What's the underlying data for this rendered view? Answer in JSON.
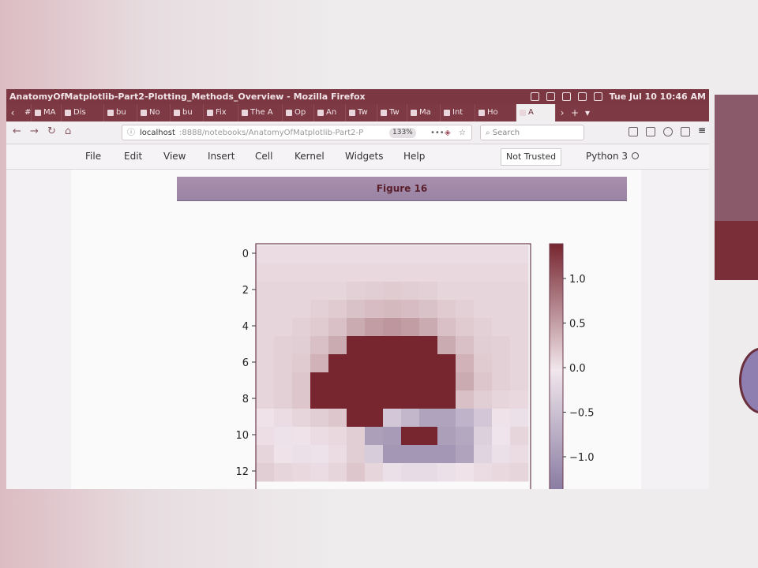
{
  "window": {
    "title": "AnatomyOfMatplotlib-Part2-Plotting_Methods_Overview - Mozilla Firefox",
    "clock": "Tue Jul 10 10:46 AM"
  },
  "tabs": [
    {
      "label": "#",
      "active": false
    },
    {
      "label": "MA",
      "active": false
    },
    {
      "label": "Dis",
      "active": false
    },
    {
      "label": "bu",
      "active": false
    },
    {
      "label": "No",
      "active": false
    },
    {
      "label": "bu",
      "active": false
    },
    {
      "label": "Fix",
      "active": false
    },
    {
      "label": "The A",
      "active": false
    },
    {
      "label": "Op",
      "active": false
    },
    {
      "label": "An",
      "active": false
    },
    {
      "label": "Tw",
      "active": false
    },
    {
      "label": "Tw",
      "active": false
    },
    {
      "label": "Ma",
      "active": false
    },
    {
      "label": "Int",
      "active": false
    },
    {
      "label": "Ho",
      "active": false
    },
    {
      "label": "A",
      "active": true
    }
  ],
  "nav": {
    "url_host": "localhost",
    "url_path": ":8888/notebooks/AnatomyOfMatplotlib-Part2-P",
    "zoom": "133%",
    "search_placeholder": "Search",
    "more": "•••"
  },
  "jupyter_menu": {
    "items": [
      "File",
      "Edit",
      "View",
      "Insert",
      "Cell",
      "Kernel",
      "Widgets",
      "Help"
    ],
    "trust": "Not Trusted",
    "kernel": "Python 3"
  },
  "figure": {
    "title": "Figure 16"
  },
  "colors": {
    "ubuntu_bar": "#7b3843",
    "tab_bar": "#7d3944",
    "heat_low": "#84769e",
    "heat_mid": "#f1e6ec",
    "heat_high": "#77262f"
  },
  "chart_data": {
    "type": "heatmap",
    "y_ticks": [
      "0",
      "2",
      "4",
      "6",
      "8",
      "10",
      "12"
    ],
    "colorbar_ticks": [
      "1.0",
      "0.5",
      "0.0",
      "−0.5",
      "−1.0"
    ],
    "colorbar_tick_values": [
      1.0,
      0.5,
      0.0,
      -0.5,
      -1.0
    ],
    "vmin": -1.35,
    "vmax": 1.4,
    "visible_rows": 13,
    "cols": 15,
    "values": [
      [
        0.1,
        0.1,
        0.1,
        0.1,
        0.1,
        0.1,
        0.1,
        0.1,
        0.1,
        0.1,
        0.1,
        0.1,
        0.1,
        0.1,
        0.1
      ],
      [
        0.12,
        0.12,
        0.12,
        0.12,
        0.12,
        0.12,
        0.12,
        0.12,
        0.12,
        0.12,
        0.12,
        0.12,
        0.12,
        0.12,
        0.12
      ],
      [
        0.15,
        0.15,
        0.15,
        0.15,
        0.15,
        0.18,
        0.2,
        0.22,
        0.2,
        0.18,
        0.15,
        0.15,
        0.15,
        0.15,
        0.15
      ],
      [
        0.15,
        0.15,
        0.15,
        0.18,
        0.22,
        0.28,
        0.32,
        0.35,
        0.32,
        0.28,
        0.22,
        0.18,
        0.15,
        0.15,
        0.15
      ],
      [
        0.15,
        0.15,
        0.18,
        0.22,
        0.3,
        0.45,
        0.55,
        0.6,
        0.55,
        0.45,
        0.3,
        0.22,
        0.18,
        0.15,
        0.15
      ],
      [
        0.15,
        0.18,
        0.2,
        0.3,
        0.45,
        1.4,
        1.4,
        1.4,
        1.4,
        1.4,
        0.45,
        0.3,
        0.2,
        0.18,
        0.15
      ],
      [
        0.15,
        0.18,
        0.22,
        0.4,
        1.4,
        1.4,
        1.4,
        1.4,
        1.4,
        1.4,
        1.4,
        0.4,
        0.22,
        0.18,
        0.15
      ],
      [
        0.15,
        0.18,
        0.25,
        1.4,
        1.4,
        1.4,
        1.4,
        1.4,
        1.4,
        1.4,
        1.4,
        0.45,
        0.25,
        0.18,
        0.15
      ],
      [
        0.15,
        0.18,
        0.25,
        1.4,
        1.4,
        1.4,
        1.4,
        1.4,
        1.4,
        1.4,
        1.4,
        0.3,
        0.2,
        0.15,
        0.12
      ],
      [
        0.05,
        0.1,
        0.15,
        0.2,
        0.25,
        1.4,
        1.4,
        -0.35,
        -0.55,
        -0.8,
        -0.8,
        -0.6,
        -0.35,
        0.05,
        -0.05
      ],
      [
        0.08,
        -0.02,
        0.05,
        0.1,
        0.12,
        0.2,
        -0.85,
        -0.9,
        1.4,
        1.4,
        -0.85,
        -0.75,
        -0.25,
        0.0,
        0.15
      ],
      [
        0.15,
        0.05,
        -0.05,
        -0.02,
        0.1,
        0.2,
        -0.3,
        -0.95,
        -0.95,
        -0.95,
        -0.95,
        -0.8,
        -0.2,
        -0.05,
        0.1
      ],
      [
        0.2,
        0.15,
        0.12,
        0.1,
        0.15,
        0.25,
        0.15,
        -0.05,
        -0.1,
        -0.1,
        -0.05,
        0.05,
        0.1,
        0.12,
        0.15
      ]
    ]
  }
}
